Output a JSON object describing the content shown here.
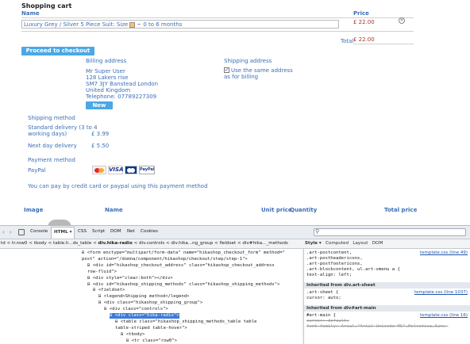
{
  "cart": {
    "title": "Shopping cart",
    "col_name": "Name",
    "col_price": "Price",
    "product": "Luxury Grey / Silver 5 Piece Suit: Size",
    "option_value": "~ 0 to 6 months",
    "price": "£ 22.00",
    "total_label": "Total",
    "total": "£ 22.00",
    "checkout_btn": "Proceed to checkout"
  },
  "billing": {
    "title": "Billing address",
    "lines": [
      "Mr Super User",
      "128 Lakers rise",
      "SM7 3JY Banstead London",
      "United Kingdom",
      "Telephone: 07789227309"
    ],
    "new_btn": "New"
  },
  "shipping_address": {
    "title": "Shipping address",
    "same_line1": "Use the same address",
    "same_line2": "as for billing",
    "checked": true
  },
  "shipping": {
    "title": "Shipping method",
    "std_l1": "Standard delivery (3 to 4",
    "std_l2": "working days)",
    "std_price": "£ 3.99",
    "next": "Next day delivery",
    "next_price": "£ 5.50"
  },
  "payment": {
    "title": "Payment method",
    "paypal": "PayPal",
    "note": "You can pay by credit card or paypal using this payment method",
    "cards": [
      "Mastercard",
      "VISA",
      "Mastercard",
      "PayPal"
    ]
  },
  "cart2": {
    "image": "Image",
    "name": "Name",
    "unit": "Unit price",
    "qty": "Quantity",
    "total": "Total price"
  },
  "firebug": {
    "tabs": [
      "Console",
      "HTML",
      "CSS",
      "Script",
      "DOM",
      "Net",
      "Cookies"
    ],
    "active_tab": "HTML",
    "breadcrumbs": [
      "td",
      "tr.row0",
      "tbody",
      "table.h...ds_table",
      "div.hika-radio",
      "div.controls",
      "div.hika...ng_group",
      "fieldset",
      "div#hika..._methods"
    ],
    "right_tabs": [
      "Style",
      "Computed",
      "Layout",
      "DOM"
    ],
    "html_lines": [
      {
        "i": 1,
        "t": "<form enctype=\"multipart/form-data\" name=\"hikashop_checkout_form\" method=\""
      },
      {
        "i": 1,
        "t": "post\" action=\"/dsmna/component/hikashop/checkout/step/step-1\">"
      },
      {
        "i": 2,
        "t": "<div id=\"hikashop_checkout_address\" class=\"hikashop_checkout_address"
      },
      {
        "i": 2,
        "t": "row-fluid\">"
      },
      {
        "i": 2,
        "t": "<div style=\"clear:both\"></div>"
      },
      {
        "i": 2,
        "t": "<div id=\"hikashop_shipping_methods\" class=\"hikashop_shipping_methods\">"
      },
      {
        "i": 3,
        "t": "<fieldset>"
      },
      {
        "i": 4,
        "t": "<legend>Shipping method</legend>"
      },
      {
        "i": 4,
        "t": "<div class=\"hikashop_shipping_group\">"
      },
      {
        "i": 5,
        "t": "<div class=\"controls\">"
      },
      {
        "i": 6,
        "t": "<div class=\"hika-radio\">",
        "sel": true
      },
      {
        "i": 7,
        "t": "<table class=\"hikashop_shipping_methods_table table"
      },
      {
        "i": 7,
        "t": "table-striped table-hover\">"
      },
      {
        "i": 8,
        "t": "<tbody>"
      },
      {
        "i": 9,
        "t": "<tr class=\"row0\">"
      }
    ],
    "css_blocks": [
      {
        "lines": [
          ".art-postcontent,",
          ".art-postheadericons,",
          ".art-postfootericons,",
          ".art-blockcontent, ul.art-vmenu a {",
          "    text-align: left;"
        ],
        "src": "template.css (line 49)"
      },
      {
        "inherit": "Inherited from div.art-sheet"
      },
      {
        "lines": [
          ".art-sheet {",
          "    cursor: auto;"
        ],
        "src": "template.css (line 1037)"
      },
      {
        "inherit": "Inherited from div#art-main"
      },
      {
        "lines": [
          "#art-main {",
          "    cursor: default;",
          "    font-family: Arial,\"Arial Unicode MS\",Helvetica,Sans-"
        ],
        "src": "template.css (line 16)"
      }
    ]
  }
}
